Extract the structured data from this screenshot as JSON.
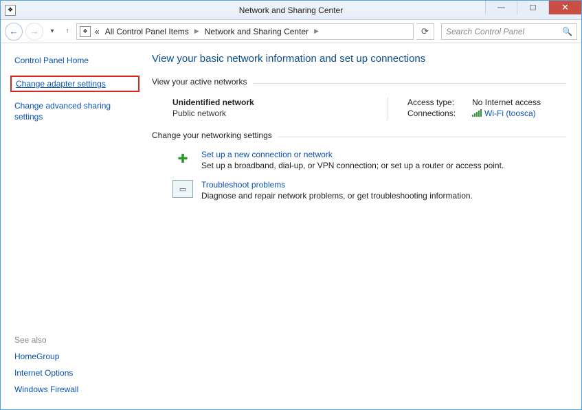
{
  "window": {
    "title": "Network and Sharing Center"
  },
  "breadcrumb": {
    "root_symbol": "«",
    "item1": "All Control Panel Items",
    "item2": "Network and Sharing Center"
  },
  "search": {
    "placeholder": "Search Control Panel"
  },
  "sidebar": {
    "home": "Control Panel Home",
    "change_adapter": "Change adapter settings",
    "change_advanced": "Change advanced sharing settings",
    "see_also_header": "See also",
    "see_also": {
      "homegroup": "HomeGroup",
      "internet_options": "Internet Options",
      "windows_firewall": "Windows Firewall"
    }
  },
  "main": {
    "heading": "View your basic network information and set up connections",
    "active_networks_label": "View your active networks",
    "network": {
      "name": "Unidentified network",
      "type": "Public network",
      "access_type_label": "Access type:",
      "access_type_value": "No Internet access",
      "connections_label": "Connections:",
      "connection_name": "Wi-Fi (toosca)"
    },
    "change_settings_label": "Change your networking settings",
    "options": {
      "setup": {
        "title": "Set up a new connection or network",
        "desc": "Set up a broadband, dial-up, or VPN connection; or set up a router or access point."
      },
      "troubleshoot": {
        "title": "Troubleshoot problems",
        "desc": "Diagnose and repair network problems, or get troubleshooting information."
      }
    }
  }
}
